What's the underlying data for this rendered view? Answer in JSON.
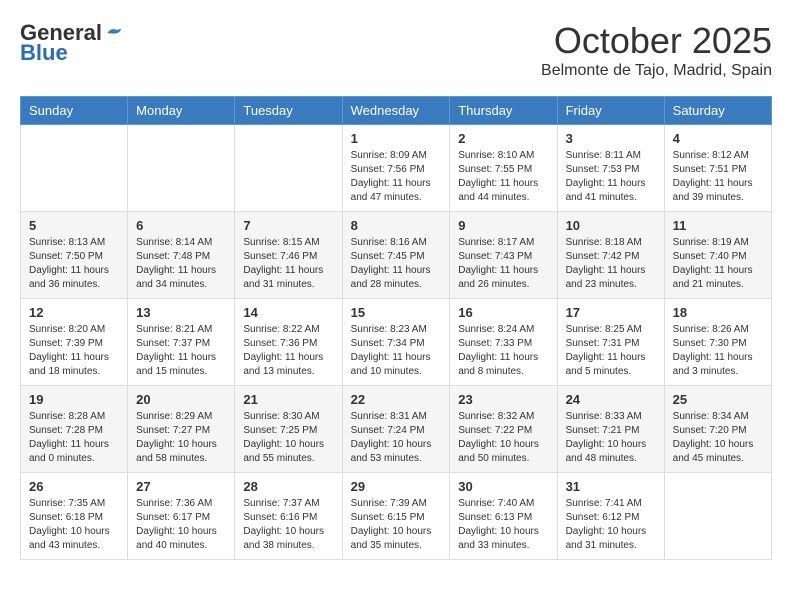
{
  "header": {
    "logo_general": "General",
    "logo_blue": "Blue",
    "month_title": "October 2025",
    "location": "Belmonte de Tajo, Madrid, Spain"
  },
  "days_of_week": [
    "Sunday",
    "Monday",
    "Tuesday",
    "Wednesday",
    "Thursday",
    "Friday",
    "Saturday"
  ],
  "weeks": [
    {
      "days": [
        {
          "number": "",
          "sunrise": "",
          "sunset": "",
          "daylight": ""
        },
        {
          "number": "",
          "sunrise": "",
          "sunset": "",
          "daylight": ""
        },
        {
          "number": "",
          "sunrise": "",
          "sunset": "",
          "daylight": ""
        },
        {
          "number": "1",
          "sunrise": "Sunrise: 8:09 AM",
          "sunset": "Sunset: 7:56 PM",
          "daylight": "Daylight: 11 hours and 47 minutes."
        },
        {
          "number": "2",
          "sunrise": "Sunrise: 8:10 AM",
          "sunset": "Sunset: 7:55 PM",
          "daylight": "Daylight: 11 hours and 44 minutes."
        },
        {
          "number": "3",
          "sunrise": "Sunrise: 8:11 AM",
          "sunset": "Sunset: 7:53 PM",
          "daylight": "Daylight: 11 hours and 41 minutes."
        },
        {
          "number": "4",
          "sunrise": "Sunrise: 8:12 AM",
          "sunset": "Sunset: 7:51 PM",
          "daylight": "Daylight: 11 hours and 39 minutes."
        }
      ]
    },
    {
      "days": [
        {
          "number": "5",
          "sunrise": "Sunrise: 8:13 AM",
          "sunset": "Sunset: 7:50 PM",
          "daylight": "Daylight: 11 hours and 36 minutes."
        },
        {
          "number": "6",
          "sunrise": "Sunrise: 8:14 AM",
          "sunset": "Sunset: 7:48 PM",
          "daylight": "Daylight: 11 hours and 34 minutes."
        },
        {
          "number": "7",
          "sunrise": "Sunrise: 8:15 AM",
          "sunset": "Sunset: 7:46 PM",
          "daylight": "Daylight: 11 hours and 31 minutes."
        },
        {
          "number": "8",
          "sunrise": "Sunrise: 8:16 AM",
          "sunset": "Sunset: 7:45 PM",
          "daylight": "Daylight: 11 hours and 28 minutes."
        },
        {
          "number": "9",
          "sunrise": "Sunrise: 8:17 AM",
          "sunset": "Sunset: 7:43 PM",
          "daylight": "Daylight: 11 hours and 26 minutes."
        },
        {
          "number": "10",
          "sunrise": "Sunrise: 8:18 AM",
          "sunset": "Sunset: 7:42 PM",
          "daylight": "Daylight: 11 hours and 23 minutes."
        },
        {
          "number": "11",
          "sunrise": "Sunrise: 8:19 AM",
          "sunset": "Sunset: 7:40 PM",
          "daylight": "Daylight: 11 hours and 21 minutes."
        }
      ]
    },
    {
      "days": [
        {
          "number": "12",
          "sunrise": "Sunrise: 8:20 AM",
          "sunset": "Sunset: 7:39 PM",
          "daylight": "Daylight: 11 hours and 18 minutes."
        },
        {
          "number": "13",
          "sunrise": "Sunrise: 8:21 AM",
          "sunset": "Sunset: 7:37 PM",
          "daylight": "Daylight: 11 hours and 15 minutes."
        },
        {
          "number": "14",
          "sunrise": "Sunrise: 8:22 AM",
          "sunset": "Sunset: 7:36 PM",
          "daylight": "Daylight: 11 hours and 13 minutes."
        },
        {
          "number": "15",
          "sunrise": "Sunrise: 8:23 AM",
          "sunset": "Sunset: 7:34 PM",
          "daylight": "Daylight: 11 hours and 10 minutes."
        },
        {
          "number": "16",
          "sunrise": "Sunrise: 8:24 AM",
          "sunset": "Sunset: 7:33 PM",
          "daylight": "Daylight: 11 hours and 8 minutes."
        },
        {
          "number": "17",
          "sunrise": "Sunrise: 8:25 AM",
          "sunset": "Sunset: 7:31 PM",
          "daylight": "Daylight: 11 hours and 5 minutes."
        },
        {
          "number": "18",
          "sunrise": "Sunrise: 8:26 AM",
          "sunset": "Sunset: 7:30 PM",
          "daylight": "Daylight: 11 hours and 3 minutes."
        }
      ]
    },
    {
      "days": [
        {
          "number": "19",
          "sunrise": "Sunrise: 8:28 AM",
          "sunset": "Sunset: 7:28 PM",
          "daylight": "Daylight: 11 hours and 0 minutes."
        },
        {
          "number": "20",
          "sunrise": "Sunrise: 8:29 AM",
          "sunset": "Sunset: 7:27 PM",
          "daylight": "Daylight: 10 hours and 58 minutes."
        },
        {
          "number": "21",
          "sunrise": "Sunrise: 8:30 AM",
          "sunset": "Sunset: 7:25 PM",
          "daylight": "Daylight: 10 hours and 55 minutes."
        },
        {
          "number": "22",
          "sunrise": "Sunrise: 8:31 AM",
          "sunset": "Sunset: 7:24 PM",
          "daylight": "Daylight: 10 hours and 53 minutes."
        },
        {
          "number": "23",
          "sunrise": "Sunrise: 8:32 AM",
          "sunset": "Sunset: 7:22 PM",
          "daylight": "Daylight: 10 hours and 50 minutes."
        },
        {
          "number": "24",
          "sunrise": "Sunrise: 8:33 AM",
          "sunset": "Sunset: 7:21 PM",
          "daylight": "Daylight: 10 hours and 48 minutes."
        },
        {
          "number": "25",
          "sunrise": "Sunrise: 8:34 AM",
          "sunset": "Sunset: 7:20 PM",
          "daylight": "Daylight: 10 hours and 45 minutes."
        }
      ]
    },
    {
      "days": [
        {
          "number": "26",
          "sunrise": "Sunrise: 7:35 AM",
          "sunset": "Sunset: 6:18 PM",
          "daylight": "Daylight: 10 hours and 43 minutes."
        },
        {
          "number": "27",
          "sunrise": "Sunrise: 7:36 AM",
          "sunset": "Sunset: 6:17 PM",
          "daylight": "Daylight: 10 hours and 40 minutes."
        },
        {
          "number": "28",
          "sunrise": "Sunrise: 7:37 AM",
          "sunset": "Sunset: 6:16 PM",
          "daylight": "Daylight: 10 hours and 38 minutes."
        },
        {
          "number": "29",
          "sunrise": "Sunrise: 7:39 AM",
          "sunset": "Sunset: 6:15 PM",
          "daylight": "Daylight: 10 hours and 35 minutes."
        },
        {
          "number": "30",
          "sunrise": "Sunrise: 7:40 AM",
          "sunset": "Sunset: 6:13 PM",
          "daylight": "Daylight: 10 hours and 33 minutes."
        },
        {
          "number": "31",
          "sunrise": "Sunrise: 7:41 AM",
          "sunset": "Sunset: 6:12 PM",
          "daylight": "Daylight: 10 hours and 31 minutes."
        },
        {
          "number": "",
          "sunrise": "",
          "sunset": "",
          "daylight": ""
        }
      ]
    }
  ]
}
